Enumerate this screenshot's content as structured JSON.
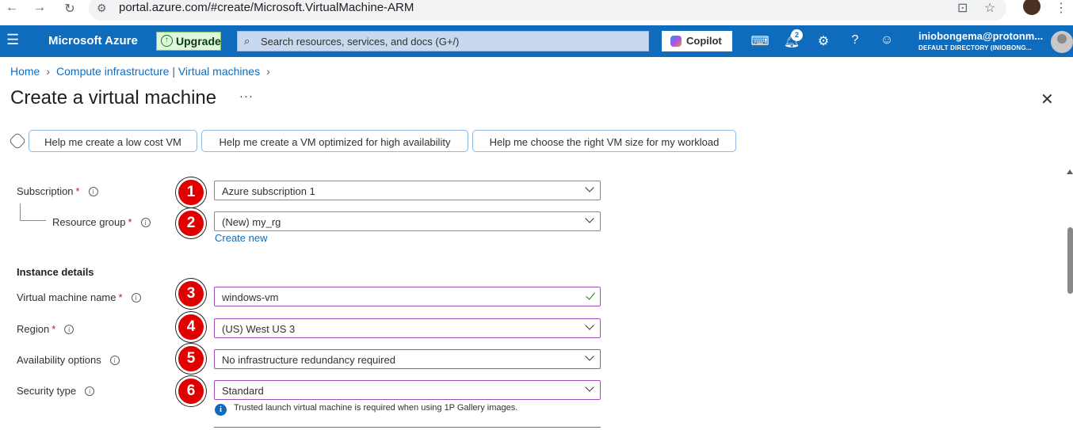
{
  "browser": {
    "url": "portal.azure.com/#create/Microsoft.VirtualMachine-ARM"
  },
  "topbar": {
    "brand": "Microsoft Azure",
    "upgrade_label": "Upgrade",
    "search_placeholder": "Search resources, services, and docs (G+/)",
    "copilot_label": "Copilot",
    "notification_count": "2",
    "account_email": "iniobongema@protonm...",
    "account_directory": "DEFAULT DIRECTORY (INIOBONG..."
  },
  "breadcrumb": {
    "items": [
      "Home",
      "Compute infrastructure | Virtual machines"
    ]
  },
  "page": {
    "title": "Create a virtual machine",
    "more": "···"
  },
  "helpers": [
    "Help me create a low cost VM",
    "Help me create a VM optimized for high availability",
    "Help me choose the right VM size for my workload"
  ],
  "form": {
    "subscription": {
      "label": "Subscription",
      "value": "Azure subscription 1",
      "required": "*"
    },
    "resource_group": {
      "label": "Resource group",
      "value": "(New) my_rg",
      "required": "*",
      "create_new": "Create new"
    },
    "instance_details_heading": "Instance details",
    "vm_name": {
      "label": "Virtual machine name",
      "value": "windows-vm",
      "required": "*"
    },
    "region": {
      "label": "Region",
      "value": "(US) West US 3",
      "required": "*"
    },
    "availability": {
      "label": "Availability options",
      "value": "No infrastructure redundancy required"
    },
    "security_type": {
      "label": "Security type",
      "value": "Standard"
    },
    "security_note": "Trusted launch virtual machine is required when using 1P Gallery images."
  },
  "markers": [
    "1",
    "2",
    "3",
    "4",
    "5",
    "6"
  ],
  "icons": {
    "back": "back-arrow-icon",
    "forward": "forward-arrow-icon",
    "reload": "reload-icon",
    "menu": "hamburger-icon",
    "search": "search-icon",
    "cloud_shell": "cloud-shell-icon",
    "notifications": "bell-icon",
    "settings": "gear-icon",
    "help": "help-icon",
    "feedback": "feedback-icon"
  },
  "colors": {
    "azure_blue": "#0f6cbd",
    "marker_red": "#e00000",
    "field_focus_purple": "#9c4fb8",
    "required_red": "#a4262c",
    "valid_green": "#107c10"
  }
}
